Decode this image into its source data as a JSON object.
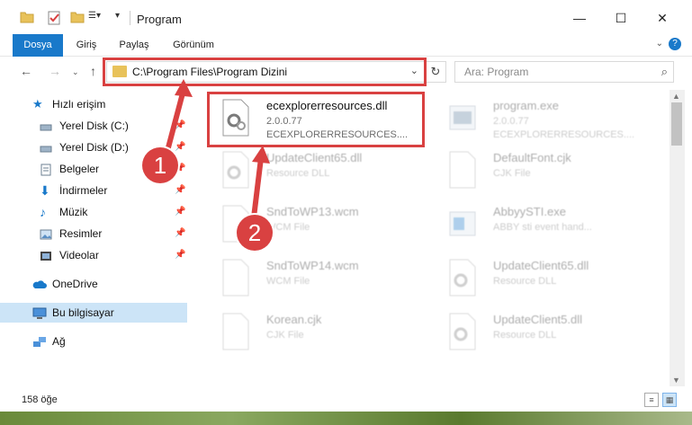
{
  "window": {
    "title": "Program"
  },
  "ribbon": {
    "tabs": [
      "Dosya",
      "Giriş",
      "Paylaş",
      "Görünüm"
    ]
  },
  "address": {
    "path": "C:\\Program Files\\Program Dizini"
  },
  "search": {
    "placeholder": "Ara: Program"
  },
  "sidebar": {
    "items": [
      {
        "label": "Hızlı erişim",
        "icon": "star-icon",
        "pinned": false
      },
      {
        "label": "Yerel Disk (C:)",
        "icon": "drive-icon",
        "pinned": true
      },
      {
        "label": "Yerel Disk (D:)",
        "icon": "drive-icon",
        "pinned": true
      },
      {
        "label": "Belgeler",
        "icon": "documents-icon",
        "pinned": true
      },
      {
        "label": "İndirmeler",
        "icon": "download-icon",
        "pinned": true
      },
      {
        "label": "Müzik",
        "icon": "music-icon",
        "pinned": true
      },
      {
        "label": "Resimler",
        "icon": "pictures-icon",
        "pinned": true
      },
      {
        "label": "Videolar",
        "icon": "video-icon",
        "pinned": true
      },
      {
        "label": "OneDrive",
        "icon": "cloud-icon",
        "pinned": false
      },
      {
        "label": "Bu bilgisayar",
        "icon": "computer-icon",
        "pinned": false
      },
      {
        "label": "Ağ",
        "icon": "network-icon",
        "pinned": false
      }
    ]
  },
  "files": [
    {
      "name": "ecexplorerresources.dll",
      "line2": "2.0.0.77",
      "line3": "ECEXPLORERRESOURCES....",
      "icon": "dll-gear-icon"
    },
    {
      "name": "program.exe",
      "line2": "2.0.0.77",
      "line3": "ECEXPLORERRESOURCES....",
      "icon": "exe-icon"
    },
    {
      "name": "UpdateClient65.dll",
      "line2": "Resource DLL",
      "line3": "",
      "icon": "dll-gear-icon"
    },
    {
      "name": "DefaultFont.cjk",
      "line2": "CJK File",
      "line3": "",
      "icon": "file-icon"
    },
    {
      "name": "SndToWP13.wcm",
      "line2": "WCM File",
      "line3": "",
      "icon": "file-icon"
    },
    {
      "name": "AbbyySTI.exe",
      "line2": "ABBY sti event hand...",
      "line3": "",
      "icon": "exe-icon"
    },
    {
      "name": "SndToWP14.wcm",
      "line2": "WCM File",
      "line3": "",
      "icon": "file-icon"
    },
    {
      "name": "UpdateClient65.dll",
      "line2": "Resource DLL",
      "line3": "",
      "icon": "dll-gear-icon"
    },
    {
      "name": "Korean.cjk",
      "line2": "CJK File",
      "line3": "",
      "icon": "file-icon"
    },
    {
      "name": "UpdateClient5.dll",
      "line2": "Resource DLL",
      "line3": "",
      "icon": "dll-gear-icon"
    }
  ],
  "status": {
    "count": "158 öğe"
  },
  "annotations": {
    "step1": "1",
    "step2": "2"
  },
  "colors": {
    "accent": "#1979ca",
    "highlight": "#d94141",
    "selected": "#cce4f7"
  }
}
